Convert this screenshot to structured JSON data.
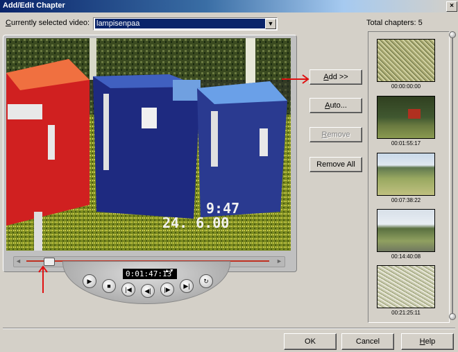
{
  "window": {
    "title": "Add/Edit Chapter",
    "close_glyph": "×"
  },
  "video_select": {
    "label_prefix": "",
    "label_accel": "C",
    "label_rest": "urrently selected video:",
    "value": "lampisenpaa",
    "arrow_glyph": "▼"
  },
  "total_chapters": "Total chapters: 5",
  "preview": {
    "timecode": "0:01:47:13",
    "overlay_time": "9:47",
    "overlay_date": "24. 6.00",
    "scrub_left_glyph": "◄",
    "scrub_right_glyph": "►",
    "stepper_glyph": "▲▼",
    "progress_fraction": 0.07
  },
  "transport": {
    "play": "▶",
    "stop": "■",
    "start": "|◀",
    "step_back": "◀|",
    "step_fwd": "|▶",
    "end": "▶|",
    "loop": "↻"
  },
  "buttons": {
    "add_accel": "A",
    "add_rest": "dd >>",
    "auto_accel": "A",
    "auto_rest": "uto...",
    "remove_accel": "R",
    "remove_rest": "emove",
    "remove_all": "Remove All"
  },
  "chapters": [
    {
      "time": "00:00:00:00",
      "scene": "grass"
    },
    {
      "time": "00:01:55:17",
      "scene": "trees"
    },
    {
      "time": "00:07:38:22",
      "scene": "field"
    },
    {
      "time": "00:14:40:08",
      "scene": "road"
    },
    {
      "time": "00:21:25:11",
      "scene": "meadow"
    }
  ],
  "dialog": {
    "ok": "OK",
    "cancel": "Cancel",
    "help_accel": "H",
    "help_rest": "elp"
  },
  "colors": {
    "title_bar": "#0a246a",
    "selection": "#0a246a",
    "annotation": "#e01010"
  }
}
